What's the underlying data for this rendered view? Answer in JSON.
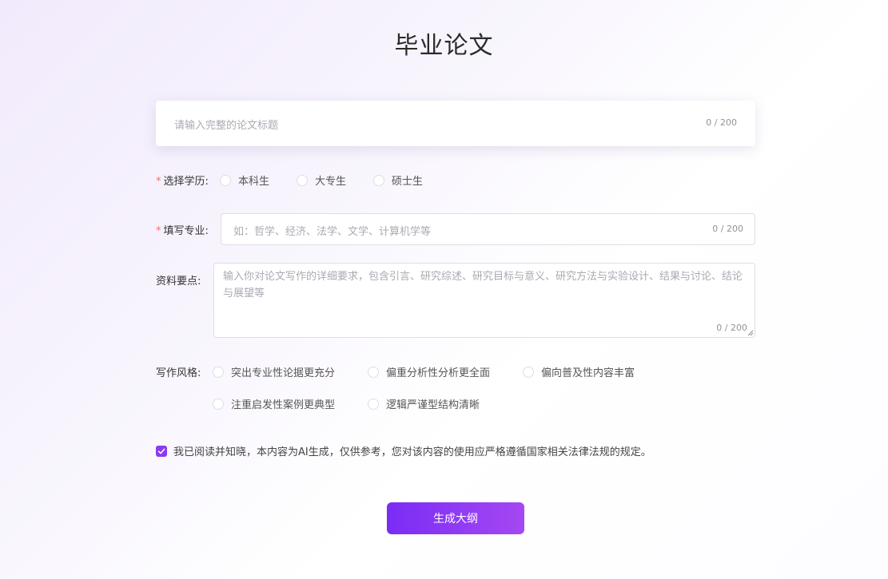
{
  "page": {
    "title": "毕业论文"
  },
  "title_input": {
    "placeholder": "请输入完整的论文标题",
    "counter": "0 / 200"
  },
  "education": {
    "required_mark": "*",
    "label": "选择学历:",
    "options": [
      "本科生",
      "大专生",
      "硕士生"
    ],
    "selected": null
  },
  "major": {
    "required_mark": "*",
    "label": "填写专业:",
    "placeholder": "如：哲学、经济、法学、文学、计算机学等",
    "counter": "0 / 200"
  },
  "points": {
    "label": "资料要点:",
    "placeholder": "输入你对论文写作的详细要求，包含引言、研究综述、研究目标与意义、研究方法与实验设计、结果与讨论、结论与展望等",
    "counter": "0 / 200"
  },
  "style": {
    "label": "写作风格:",
    "options": [
      "突出专业性论据更充分",
      "偏重分析性分析更全面",
      "偏向普及性内容丰富",
      "注重启发性案例更典型",
      "逻辑严谨型结构清晰"
    ],
    "selected": null
  },
  "agreement": {
    "checked": true,
    "text": "我已阅读并知晓，本内容为AI生成，仅供参考，您对该内容的使用应严格遵循国家相关法律法规的规定。"
  },
  "actions": {
    "generate_label": "生成大纲"
  },
  "colors": {
    "accent": "#8a3bef",
    "required": "#f56c6c",
    "button_gradient_start": "#7a2cf5",
    "button_gradient_end": "#a548f3"
  }
}
